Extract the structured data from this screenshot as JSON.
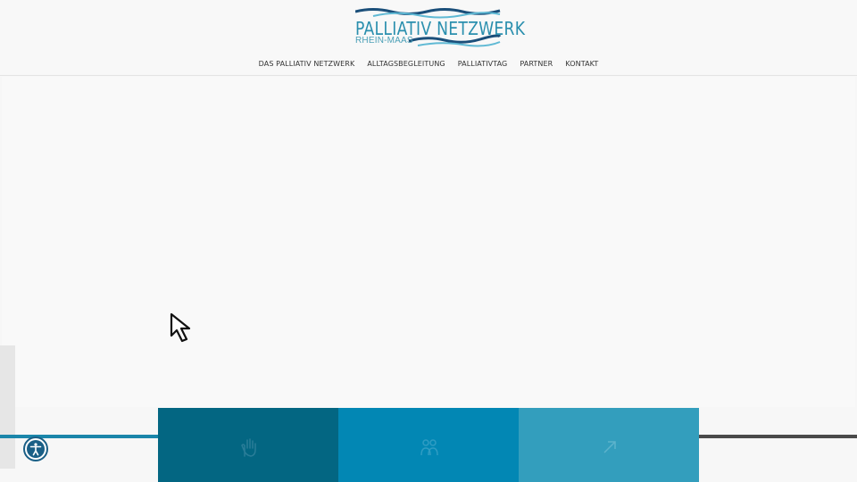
{
  "logo": {
    "title": "PALLIATIV NETZWERK",
    "subtitle": "RHEIN-MAAS"
  },
  "nav": {
    "items": [
      "DAS PALLIATIV NETZWERK",
      "ALLTAGSBEGLEITUNG",
      "PALLIATIVTAG",
      "PARTNER",
      "KONTAKT"
    ]
  },
  "tiles": [
    {
      "icon": "hand-icon",
      "color": "#036682"
    },
    {
      "icon": "people-icon",
      "color": "#0287b4"
    },
    {
      "icon": "arrow-icon",
      "color": "#339ebd"
    }
  ],
  "accessibility": {
    "icon": "accessibility-icon",
    "color": "#1a5f86"
  },
  "colors": {
    "brand": "#2a8fae",
    "accent_line": "#1b86aa",
    "dark_line": "#4a4a4a"
  }
}
